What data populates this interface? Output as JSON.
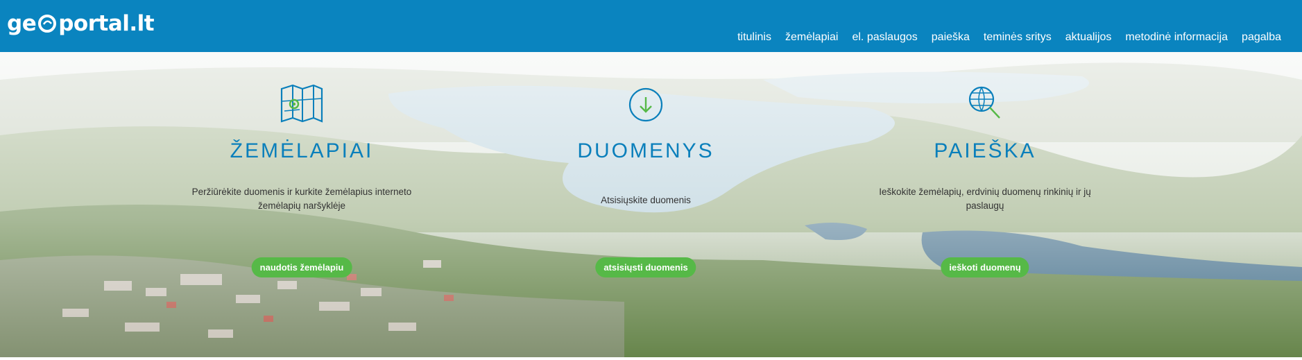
{
  "header": {
    "logo_text_left": "ge",
    "logo_text_right": "portal.lt",
    "nav": [
      {
        "label": "titulinis",
        "active": true
      },
      {
        "label": "žemėlapiai",
        "active": false
      },
      {
        "label": "el. paslaugos",
        "active": false
      },
      {
        "label": "paieška",
        "active": false
      },
      {
        "label": "teminės sritys",
        "active": false
      },
      {
        "label": "aktualijos",
        "active": false
      },
      {
        "label": "metodinė informacija",
        "active": false
      },
      {
        "label": "pagalba",
        "active": false
      }
    ]
  },
  "features": [
    {
      "icon": "map-icon",
      "title": "ŽEMĖLAPIAI",
      "description": "Peržiūrėkite duomenis ir kurkite žemėlapius interneto žemėlapių naršyklėje",
      "button": "naudotis žemėlapiu"
    },
    {
      "icon": "download-icon",
      "title": "DUOMENYS",
      "description": "Atsisiųskite duomenis",
      "button": "atsisiųsti duomenis"
    },
    {
      "icon": "search-globe-icon",
      "title": "PAIEŠKA",
      "description": "Ieškokite žemėlapių, erdvinių duomenų rinkinių ir jų paslaugų",
      "button": "ieškoti duomenų"
    }
  ],
  "colors": {
    "header_bg": "#0a84bf",
    "accent_green": "#56b947",
    "title_blue": "#0a7fbb"
  }
}
